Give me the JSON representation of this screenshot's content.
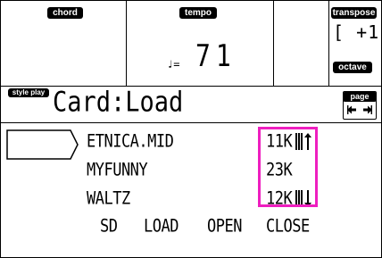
{
  "header": {
    "chord_label": "chord",
    "tempo_label": "tempo",
    "tempo_value": "71",
    "tempo_note": "♩=",
    "transpose_label": "transpose",
    "transpose_value": "[ +1",
    "octave_label": "octave"
  },
  "title_bar": {
    "mode_label": "style play",
    "title": "Card:Load",
    "page_label": "page"
  },
  "files": [
    {
      "name": "ETNICA.MID",
      "size": "11K"
    },
    {
      "name": "MYFUNNY",
      "size": "23K"
    },
    {
      "name": "WALTZ",
      "size": "12K"
    }
  ],
  "softkeys": [
    "SD",
    "LOAD",
    "OPEN",
    "CLOSE"
  ],
  "colors": {
    "highlight": "#ee1fbf",
    "lcd_ink": "#000000",
    "lcd_bg": "#ffffff"
  }
}
